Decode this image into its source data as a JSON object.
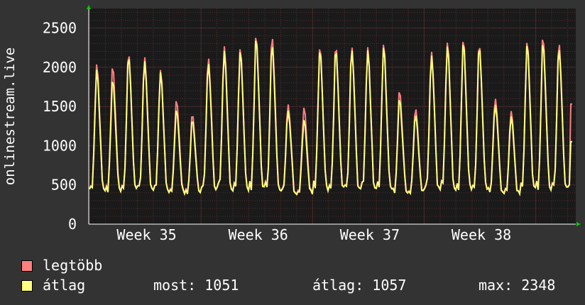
{
  "chart_data": {
    "type": "line",
    "ylabel": "onlinestream.live",
    "ylim": [
      0,
      2700
    ],
    "yticks": [
      0,
      500,
      1000,
      1500,
      2000,
      2500
    ],
    "x_tick_labels": [
      "Week 35",
      "Week 36",
      "Week 37",
      "Week 38"
    ],
    "grid": true,
    "colors": {
      "background": "#333333",
      "canvas": "#1a1a1a",
      "grid": "#5a2e2e",
      "axis": "#ffffff",
      "arrow": "#00cc00"
    },
    "series": [
      {
        "name": "legtöbb",
        "color": "#ff7f7f",
        "daily_peaks": [
          2040,
          2000,
          2190,
          2160,
          1990,
          1570,
          1390,
          2150,
          2290,
          2260,
          2380,
          2420,
          1560,
          1500,
          2250,
          2280,
          2300,
          2280,
          2300,
          1670,
          1490,
          2220,
          2350,
          2330,
          2300,
          1640,
          1460,
          2340,
          2350
        ],
        "current": 1530
      },
      {
        "name": "átlag",
        "color": "#ffff80",
        "daily_peaks": [
          1970,
          1830,
          2150,
          2110,
          1960,
          1450,
          1320,
          2080,
          2230,
          2220,
          2340,
          2310,
          1480,
          1340,
          2210,
          2240,
          2260,
          2240,
          2260,
          1570,
          1410,
          2170,
          2300,
          2290,
          2270,
          1560,
          1390,
          2300,
          2280
        ],
        "current": 1051
      }
    ]
  },
  "legend": {
    "items": [
      {
        "label": "legtöbb",
        "color": "#ff7f7f"
      },
      {
        "label": "átlag",
        "color": "#ffff80"
      }
    ],
    "stats": {
      "most": "most: 1051",
      "atlag": "átlag: 1057",
      "max": "max: 2348"
    }
  }
}
